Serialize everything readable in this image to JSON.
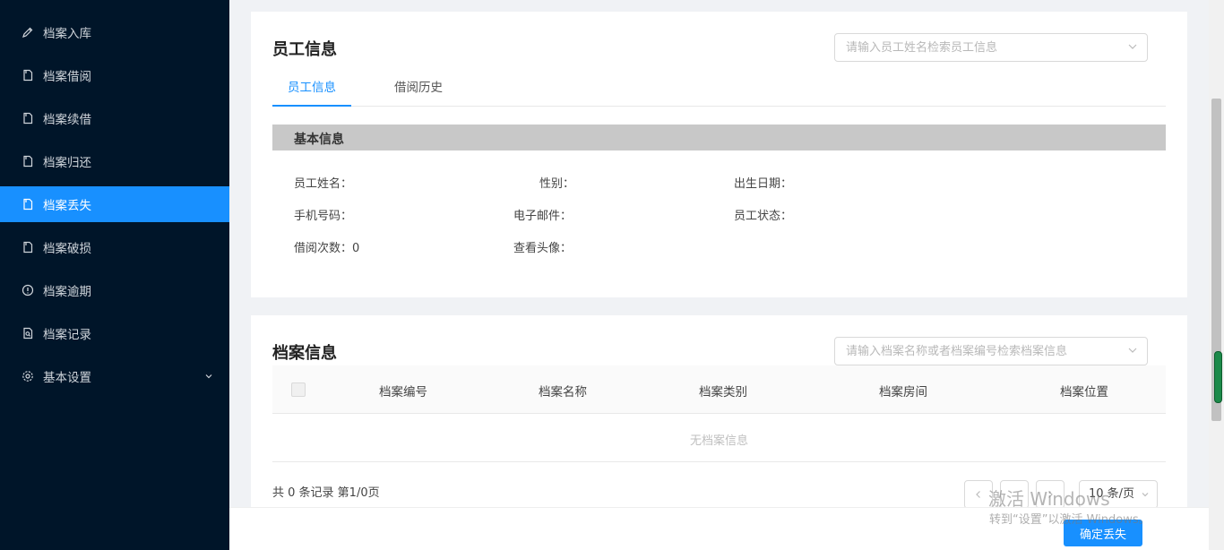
{
  "sidebar": {
    "items": [
      {
        "label": "档案入库",
        "icon": "pen-icon"
      },
      {
        "label": "档案借阅",
        "icon": "file-icon"
      },
      {
        "label": "档案续借",
        "icon": "file-icon"
      },
      {
        "label": "档案归还",
        "icon": "file-icon"
      },
      {
        "label": "档案丢失",
        "icon": "file-icon",
        "active": true
      },
      {
        "label": "档案破损",
        "icon": "file-icon"
      },
      {
        "label": "档案逾期",
        "icon": "exclamation-circle-icon"
      },
      {
        "label": "档案记录",
        "icon": "file-search-icon"
      },
      {
        "label": "基本设置",
        "icon": "gear-icon",
        "expandable": true
      }
    ],
    "active_color": "#1890ff",
    "bg_color": "#001529"
  },
  "employee": {
    "title": "员工信息",
    "search_placeholder": "请输入员工姓名检索员工信息",
    "tabs": [
      {
        "label": "员工信息",
        "active": true
      },
      {
        "label": "借阅历史"
      }
    ],
    "section_title": "基本信息",
    "fields": {
      "name_label": "员工姓名：",
      "gender_label": "性别：",
      "birth_label": "出生日期：",
      "phone_label": "手机号码：",
      "email_label": "电子邮件：",
      "status_label": "员工状态：",
      "borrow_count_label": "借阅次数：",
      "borrow_count_value": "0",
      "avatar_label": "查看头像："
    }
  },
  "archive": {
    "title": "档案信息",
    "search_placeholder": "请输入档案名称或者档案编号检索档案信息",
    "columns": [
      "档案编号",
      "档案名称",
      "档案类别",
      "档案房间",
      "档案位置"
    ],
    "empty_text": "无档案信息",
    "total_text": "共 0 条记录 第1/0页",
    "page_size": "10 条/页"
  },
  "footer": {
    "confirm_label": "确定丢失"
  },
  "watermark": {
    "line1": "激活 Windows",
    "line2": "转到“设置”以激活 Windows。"
  }
}
